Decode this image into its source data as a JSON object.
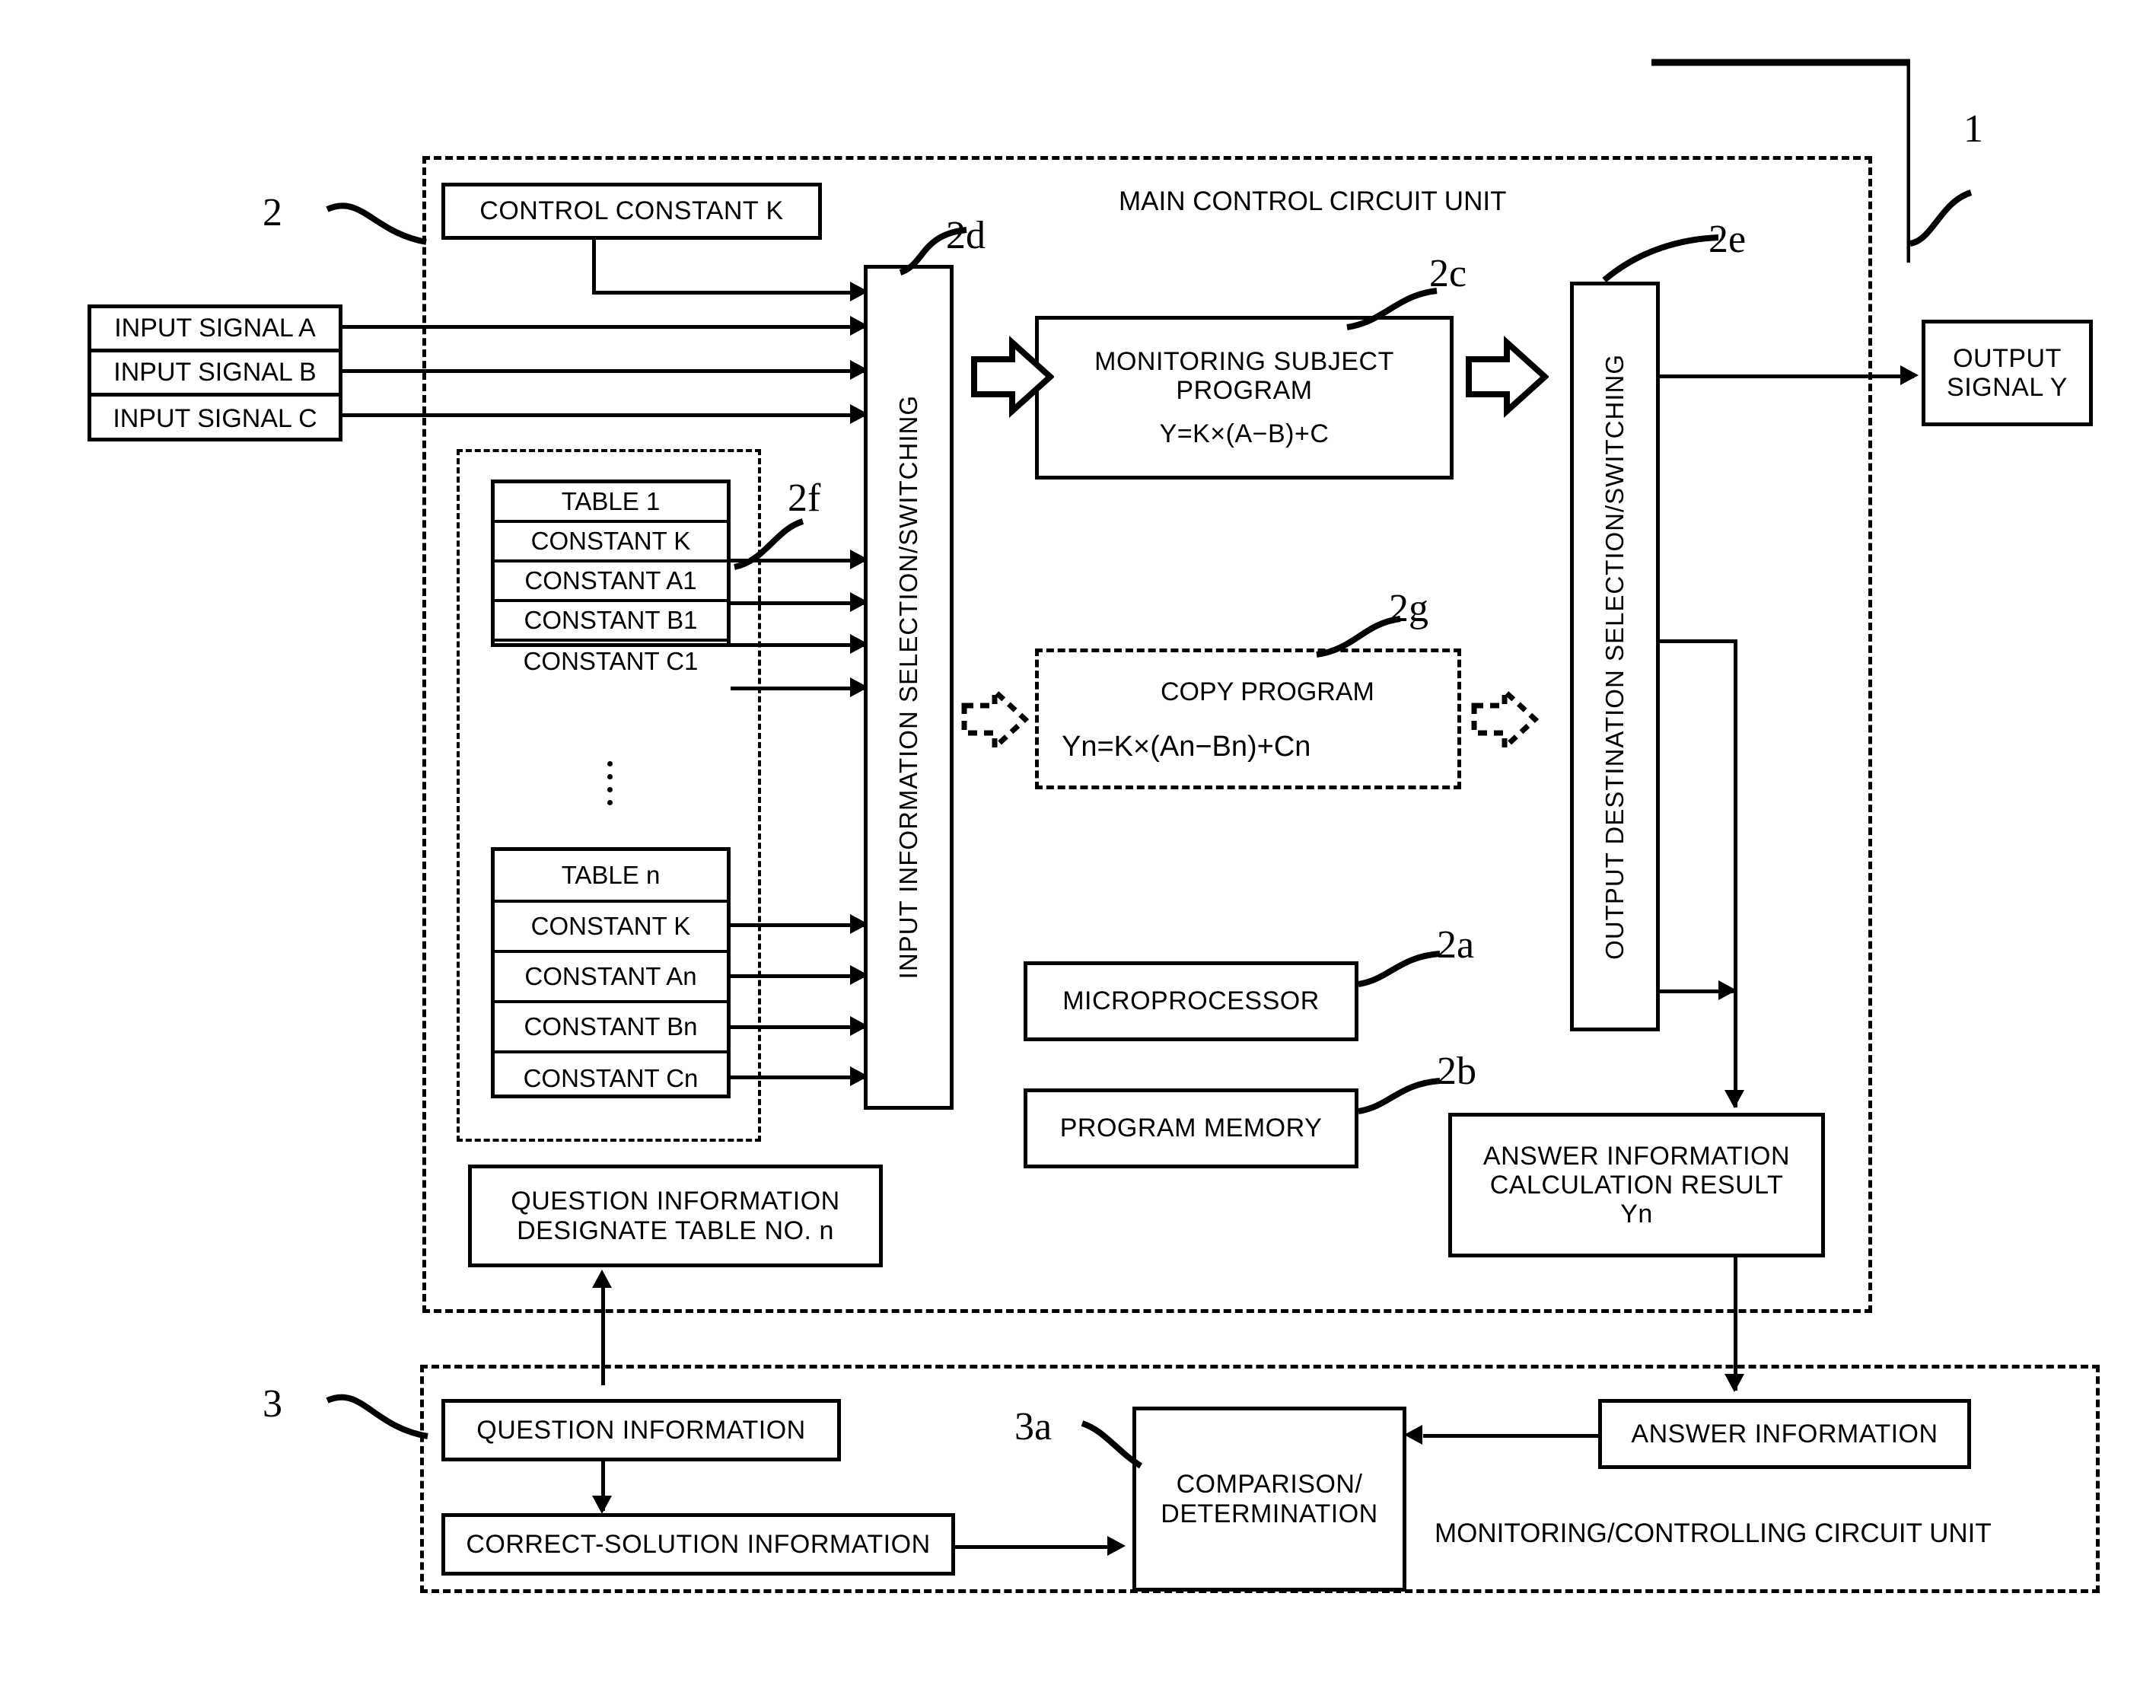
{
  "figure": {
    "ref_main_unit": "1",
    "ref_main_control": "2",
    "ref_monitor_unit": "3",
    "main_control_title": "MAIN CONTROL CIRCUIT UNIT",
    "monitoring_title": "MONITORING/CONTROLLING CIRCUIT UNIT"
  },
  "refs": {
    "microprocessor": "2a",
    "program_memory": "2b",
    "monitoring_subject_program": "2c",
    "input_selection": "2d",
    "output_selection": "2e",
    "table_group": "2f",
    "copy_program": "2g",
    "comparison": "3a"
  },
  "blocks": {
    "control_constant": "CONTROL CONSTANT K",
    "input_signals": [
      "INPUT SIGNAL A",
      "INPUT SIGNAL B",
      "INPUT SIGNAL C"
    ],
    "input_selection_switching": "INPUT INFORMATION SELECTION/SWITCHING",
    "output_selection_switching": "OUTPUT DESTINATION SELECTION/SWITCHING",
    "monitoring_subject_program": {
      "line1": "MONITORING SUBJECT",
      "line2": "PROGRAM",
      "formula": "Y=K×(A−B)+C"
    },
    "copy_program": {
      "line1": "COPY PROGRAM",
      "formula": "Yn=K×(An−Bn)+Cn"
    },
    "output_signal": {
      "line1": "OUTPUT",
      "line2": "SIGNAL Y"
    },
    "microprocessor": "MICROPROCESSOR",
    "program_memory": "PROGRAM MEMORY",
    "answer_calc_result": {
      "line1": "ANSWER INFORMATION",
      "line2": "CALCULATION RESULT",
      "line3": "Yn"
    },
    "question_info_designate": {
      "line1": "QUESTION INFORMATION",
      "line2": "DESIGNATE TABLE NO. n"
    },
    "question_information": "QUESTION INFORMATION",
    "correct_solution_information": "CORRECT-SOLUTION INFORMATION",
    "comparison_determination": {
      "line1": "COMPARISON/",
      "line2": "DETERMINATION"
    },
    "answer_information": "ANSWER INFORMATION"
  },
  "tables": [
    {
      "title": "TABLE 1",
      "rows": [
        "CONSTANT K",
        "CONSTANT A1",
        "CONSTANT B1",
        "CONSTANT C1"
      ]
    },
    {
      "title": "TABLE n",
      "rows": [
        "CONSTANT K",
        "CONSTANT An",
        "CONSTANT Bn",
        "CONSTANT Cn"
      ]
    }
  ]
}
